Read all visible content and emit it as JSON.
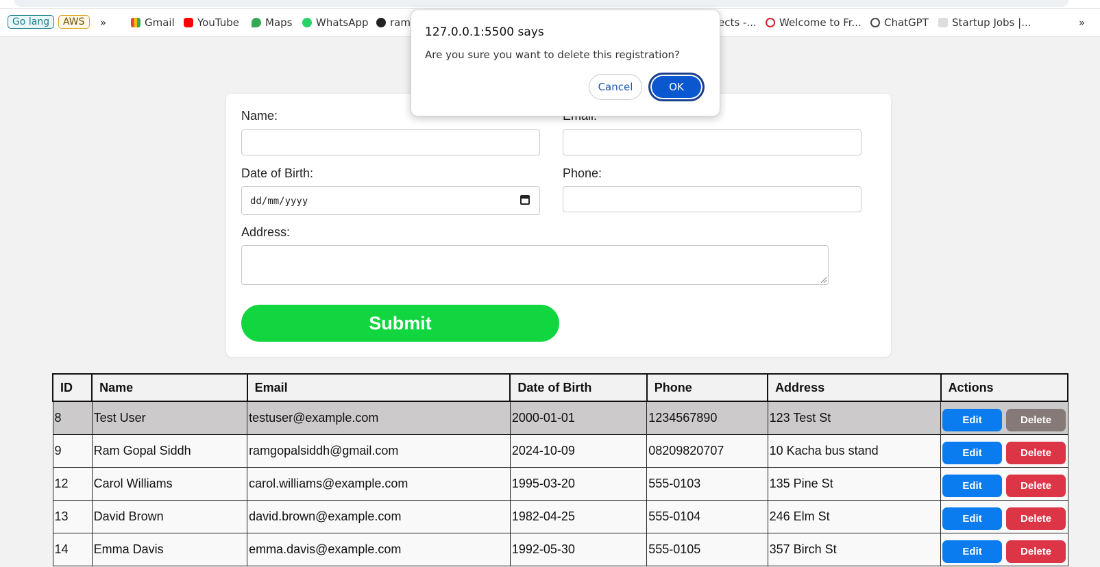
{
  "bookmarks": {
    "go_lang": "Go lang",
    "aws": "AWS",
    "more_left": "»",
    "gmail": "Gmail",
    "youtube": "YouTube",
    "maps": "Maps",
    "whatsapp": "WhatsApp",
    "github_partial": "ram",
    "projects_partial": "ects -...",
    "welcome": "Welcome to Fr...",
    "chatgpt": "ChatGPT",
    "startup_jobs": "Startup Jobs |...",
    "more_right": "»"
  },
  "dialog": {
    "title": "127.0.0.1:5500 says",
    "message": "Are you sure you want to delete this registration?",
    "cancel": "Cancel",
    "ok": "OK"
  },
  "form": {
    "name_label": "Name:",
    "email_label": "Email:",
    "dob_label": "Date of Birth:",
    "dob_placeholder": "dd/mm/yyyy",
    "phone_label": "Phone:",
    "address_label": "Address:",
    "submit": "Submit"
  },
  "table": {
    "headers": [
      "ID",
      "Name",
      "Email",
      "Date of Birth",
      "Phone",
      "Address",
      "Actions"
    ],
    "rows": [
      {
        "id": "8",
        "name": "Test User",
        "email": "testuser@example.com",
        "dob": "2000-01-01",
        "phone": "1234567890",
        "address": "123 Test St"
      },
      {
        "id": "9",
        "name": "Ram Gopal Siddh",
        "email": "ramgopalsiddh@gmail.com",
        "dob": "2024-10-09",
        "phone": "08209820707",
        "address": "10 Kacha bus stand"
      },
      {
        "id": "12",
        "name": "Carol Williams",
        "email": "carol.williams@example.com",
        "dob": "1995-03-20",
        "phone": "555-0103",
        "address": "135 Pine St"
      },
      {
        "id": "13",
        "name": "David Brown",
        "email": "david.brown@example.com",
        "dob": "1982-04-25",
        "phone": "555-0104",
        "address": "246 Elm St"
      },
      {
        "id": "14",
        "name": "Emma Davis",
        "email": "emma.davis@example.com",
        "dob": "1992-05-30",
        "phone": "555-0105",
        "address": "357 Birch St"
      }
    ],
    "edit_label": "Edit",
    "delete_label": "Delete"
  }
}
